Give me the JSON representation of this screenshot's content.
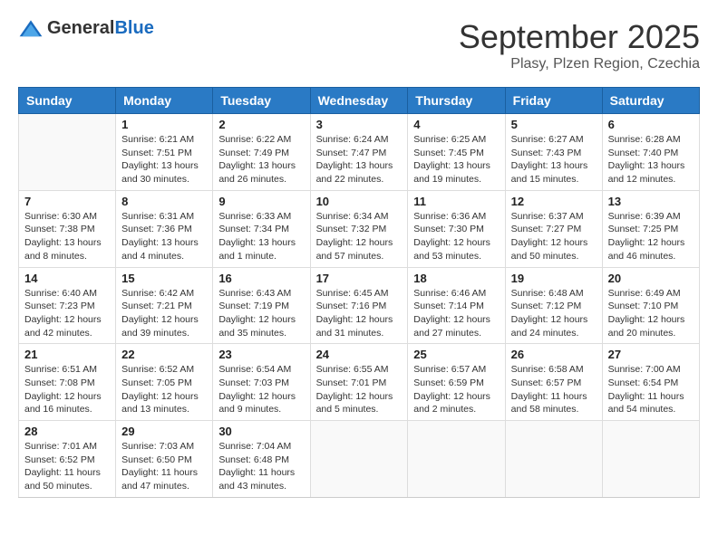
{
  "logo": {
    "general": "General",
    "blue": "Blue"
  },
  "title": "September 2025",
  "location": "Plasy, Plzen Region, Czechia",
  "days_of_week": [
    "Sunday",
    "Monday",
    "Tuesday",
    "Wednesday",
    "Thursday",
    "Friday",
    "Saturday"
  ],
  "weeks": [
    [
      {
        "day": "",
        "info": ""
      },
      {
        "day": "1",
        "info": "Sunrise: 6:21 AM\nSunset: 7:51 PM\nDaylight: 13 hours\nand 30 minutes."
      },
      {
        "day": "2",
        "info": "Sunrise: 6:22 AM\nSunset: 7:49 PM\nDaylight: 13 hours\nand 26 minutes."
      },
      {
        "day": "3",
        "info": "Sunrise: 6:24 AM\nSunset: 7:47 PM\nDaylight: 13 hours\nand 22 minutes."
      },
      {
        "day": "4",
        "info": "Sunrise: 6:25 AM\nSunset: 7:45 PM\nDaylight: 13 hours\nand 19 minutes."
      },
      {
        "day": "5",
        "info": "Sunrise: 6:27 AM\nSunset: 7:43 PM\nDaylight: 13 hours\nand 15 minutes."
      },
      {
        "day": "6",
        "info": "Sunrise: 6:28 AM\nSunset: 7:40 PM\nDaylight: 13 hours\nand 12 minutes."
      }
    ],
    [
      {
        "day": "7",
        "info": "Sunrise: 6:30 AM\nSunset: 7:38 PM\nDaylight: 13 hours\nand 8 minutes."
      },
      {
        "day": "8",
        "info": "Sunrise: 6:31 AM\nSunset: 7:36 PM\nDaylight: 13 hours\nand 4 minutes."
      },
      {
        "day": "9",
        "info": "Sunrise: 6:33 AM\nSunset: 7:34 PM\nDaylight: 13 hours\nand 1 minute."
      },
      {
        "day": "10",
        "info": "Sunrise: 6:34 AM\nSunset: 7:32 PM\nDaylight: 12 hours\nand 57 minutes."
      },
      {
        "day": "11",
        "info": "Sunrise: 6:36 AM\nSunset: 7:30 PM\nDaylight: 12 hours\nand 53 minutes."
      },
      {
        "day": "12",
        "info": "Sunrise: 6:37 AM\nSunset: 7:27 PM\nDaylight: 12 hours\nand 50 minutes."
      },
      {
        "day": "13",
        "info": "Sunrise: 6:39 AM\nSunset: 7:25 PM\nDaylight: 12 hours\nand 46 minutes."
      }
    ],
    [
      {
        "day": "14",
        "info": "Sunrise: 6:40 AM\nSunset: 7:23 PM\nDaylight: 12 hours\nand 42 minutes."
      },
      {
        "day": "15",
        "info": "Sunrise: 6:42 AM\nSunset: 7:21 PM\nDaylight: 12 hours\nand 39 minutes."
      },
      {
        "day": "16",
        "info": "Sunrise: 6:43 AM\nSunset: 7:19 PM\nDaylight: 12 hours\nand 35 minutes."
      },
      {
        "day": "17",
        "info": "Sunrise: 6:45 AM\nSunset: 7:16 PM\nDaylight: 12 hours\nand 31 minutes."
      },
      {
        "day": "18",
        "info": "Sunrise: 6:46 AM\nSunset: 7:14 PM\nDaylight: 12 hours\nand 27 minutes."
      },
      {
        "day": "19",
        "info": "Sunrise: 6:48 AM\nSunset: 7:12 PM\nDaylight: 12 hours\nand 24 minutes."
      },
      {
        "day": "20",
        "info": "Sunrise: 6:49 AM\nSunset: 7:10 PM\nDaylight: 12 hours\nand 20 minutes."
      }
    ],
    [
      {
        "day": "21",
        "info": "Sunrise: 6:51 AM\nSunset: 7:08 PM\nDaylight: 12 hours\nand 16 minutes."
      },
      {
        "day": "22",
        "info": "Sunrise: 6:52 AM\nSunset: 7:05 PM\nDaylight: 12 hours\nand 13 minutes."
      },
      {
        "day": "23",
        "info": "Sunrise: 6:54 AM\nSunset: 7:03 PM\nDaylight: 12 hours\nand 9 minutes."
      },
      {
        "day": "24",
        "info": "Sunrise: 6:55 AM\nSunset: 7:01 PM\nDaylight: 12 hours\nand 5 minutes."
      },
      {
        "day": "25",
        "info": "Sunrise: 6:57 AM\nSunset: 6:59 PM\nDaylight: 12 hours\nand 2 minutes."
      },
      {
        "day": "26",
        "info": "Sunrise: 6:58 AM\nSunset: 6:57 PM\nDaylight: 11 hours\nand 58 minutes."
      },
      {
        "day": "27",
        "info": "Sunrise: 7:00 AM\nSunset: 6:54 PM\nDaylight: 11 hours\nand 54 minutes."
      }
    ],
    [
      {
        "day": "28",
        "info": "Sunrise: 7:01 AM\nSunset: 6:52 PM\nDaylight: 11 hours\nand 50 minutes."
      },
      {
        "day": "29",
        "info": "Sunrise: 7:03 AM\nSunset: 6:50 PM\nDaylight: 11 hours\nand 47 minutes."
      },
      {
        "day": "30",
        "info": "Sunrise: 7:04 AM\nSunset: 6:48 PM\nDaylight: 11 hours\nand 43 minutes."
      },
      {
        "day": "",
        "info": ""
      },
      {
        "day": "",
        "info": ""
      },
      {
        "day": "",
        "info": ""
      },
      {
        "day": "",
        "info": ""
      }
    ]
  ]
}
